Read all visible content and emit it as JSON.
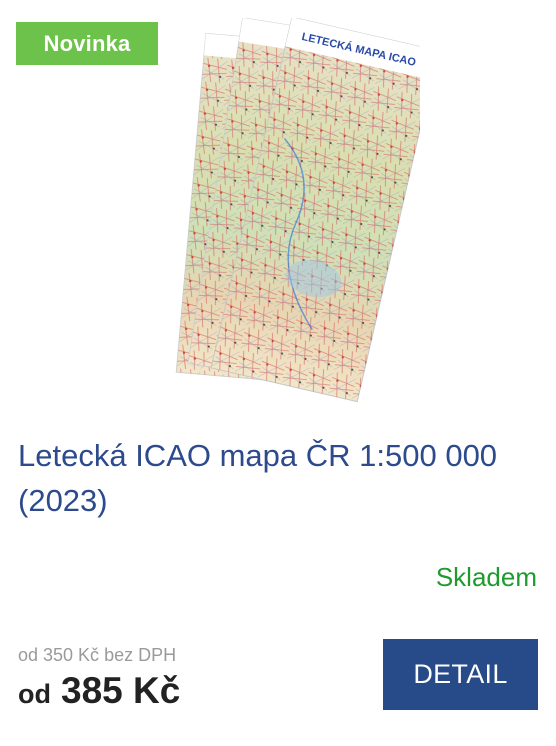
{
  "product": {
    "badge": "Novinka",
    "image_label": "LETECKÁ MAPA ICAO",
    "title_line1": "Letecká ICAO mapa ČR 1:500 000",
    "title_line2": "(2023)",
    "availability": "Skladem",
    "price_without_vat": "od 350 Kč bez DPH",
    "price_prefix": "od",
    "price_value": "385 Kč",
    "detail_label": "DETAIL"
  },
  "colors": {
    "badge_bg": "#6cc24a",
    "title": "#2c4a8c",
    "availability": "#1e9a2e",
    "button_bg": "#274a88"
  }
}
